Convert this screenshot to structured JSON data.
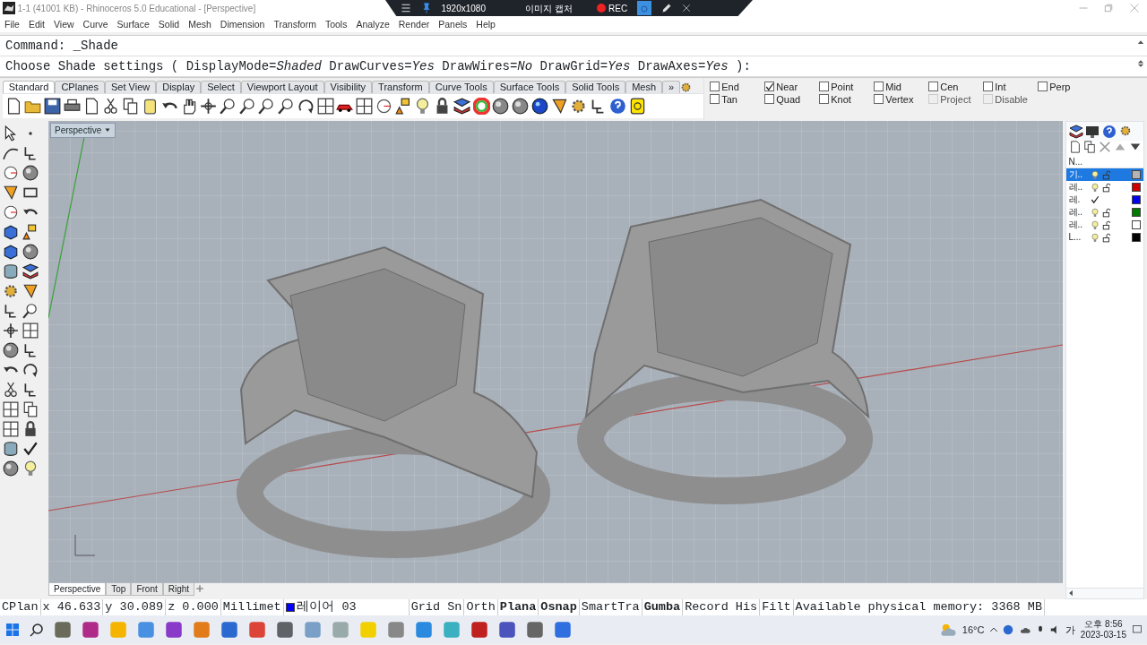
{
  "window": {
    "title": "1-1 (41001 KB) - Rhinoceros 5.0 Educational - [Perspective]"
  },
  "recorder": {
    "resolution": "1920x1080",
    "capture_label": "이미지 캡처",
    "rec_label": "REC"
  },
  "menu": [
    "File",
    "Edit",
    "View",
    "Curve",
    "Surface",
    "Solid",
    "Mesh",
    "Dimension",
    "Transform",
    "Tools",
    "Analyze",
    "Render",
    "Panels",
    "Help"
  ],
  "command": {
    "history": "Command: _Shade",
    "prompt": "Choose Shade settings ( DisplayMode=*Shaded* DrawCurves=*Yes* DrawWires=*No* DrawGrid=*Yes* DrawAxes=*Yes* ):"
  },
  "toolbar_tabs": [
    {
      "label": "Standard",
      "selected": true
    },
    {
      "label": "CPlanes",
      "selected": false
    },
    {
      "label": "Set View",
      "selected": false
    },
    {
      "label": "Display",
      "selected": false
    },
    {
      "label": "Select",
      "selected": false
    },
    {
      "label": "Viewport Layout",
      "selected": false
    },
    {
      "label": "Visibility",
      "selected": false
    },
    {
      "label": "Transform",
      "selected": false
    },
    {
      "label": "Curve Tools",
      "selected": false
    },
    {
      "label": "Surface Tools",
      "selected": false
    },
    {
      "label": "Solid Tools",
      "selected": false
    },
    {
      "label": "Mesh",
      "selected": false
    }
  ],
  "toolbar_overflow": "»",
  "osnaps": [
    {
      "label": "End",
      "checked": false,
      "disabled": false
    },
    {
      "label": "Tan",
      "checked": false,
      "disabled": false
    },
    {
      "label": "Near",
      "checked": true,
      "disabled": false
    },
    {
      "label": "Quad",
      "checked": false,
      "disabled": false
    },
    {
      "label": "Point",
      "checked": false,
      "disabled": false
    },
    {
      "label": "Knot",
      "checked": false,
      "disabled": false
    },
    {
      "label": "Mid",
      "checked": false,
      "disabled": false
    },
    {
      "label": "Vertex",
      "checked": false,
      "disabled": false
    },
    {
      "label": "Cen",
      "checked": false,
      "disabled": false
    },
    {
      "label": "Project",
      "checked": false,
      "disabled": true
    },
    {
      "label": "Int",
      "checked": false,
      "disabled": false
    },
    {
      "label": "Disable",
      "checked": false,
      "disabled": true
    },
    {
      "label": "Perp",
      "checked": false,
      "disabled": false
    }
  ],
  "viewport": {
    "label": "Perspective"
  },
  "viewport_tabs": [
    {
      "label": "Perspective",
      "selected": true
    },
    {
      "label": "Top",
      "selected": false
    },
    {
      "label": "Front",
      "selected": false
    },
    {
      "label": "Right",
      "selected": false
    }
  ],
  "layers": {
    "header": "N...",
    "rows": [
      {
        "name": "기..",
        "selected": true,
        "current": false,
        "color": "#b4b4b4"
      },
      {
        "name": "레..",
        "selected": false,
        "current": false,
        "color": "#d00000"
      },
      {
        "name": "레.",
        "selected": false,
        "current": true,
        "color": "#0000ee"
      },
      {
        "name": "레..",
        "selected": false,
        "current": false,
        "color": "#007a00"
      },
      {
        "name": "레..",
        "selected": false,
        "current": false,
        "color": "#ffffff"
      },
      {
        "name": "L...",
        "selected": false,
        "current": false,
        "color": "#000000"
      }
    ]
  },
  "status_bar": {
    "coords": [
      "CPlan",
      "x 46.633",
      "y 30.089",
      "z 0.000",
      "Millimet"
    ],
    "layer": {
      "name": "레이어 03",
      "color": "#0000ff"
    },
    "toggles": [
      {
        "label": "Grid Sn",
        "on": false
      },
      {
        "label": "Orth",
        "on": false
      },
      {
        "label": "Plana",
        "on": true
      },
      {
        "label": "Osnap",
        "on": true
      },
      {
        "label": "SmartTra",
        "on": false
      },
      {
        "label": "Gumba",
        "on": true
      },
      {
        "label": "Record His",
        "on": false
      },
      {
        "label": "Filt",
        "on": false
      }
    ],
    "memory": "Available physical memory: 3368 MB"
  },
  "taskbar": {
    "weather": "16°C",
    "ime": "가",
    "time": "오후 8:56",
    "date": "2023-03-15"
  }
}
